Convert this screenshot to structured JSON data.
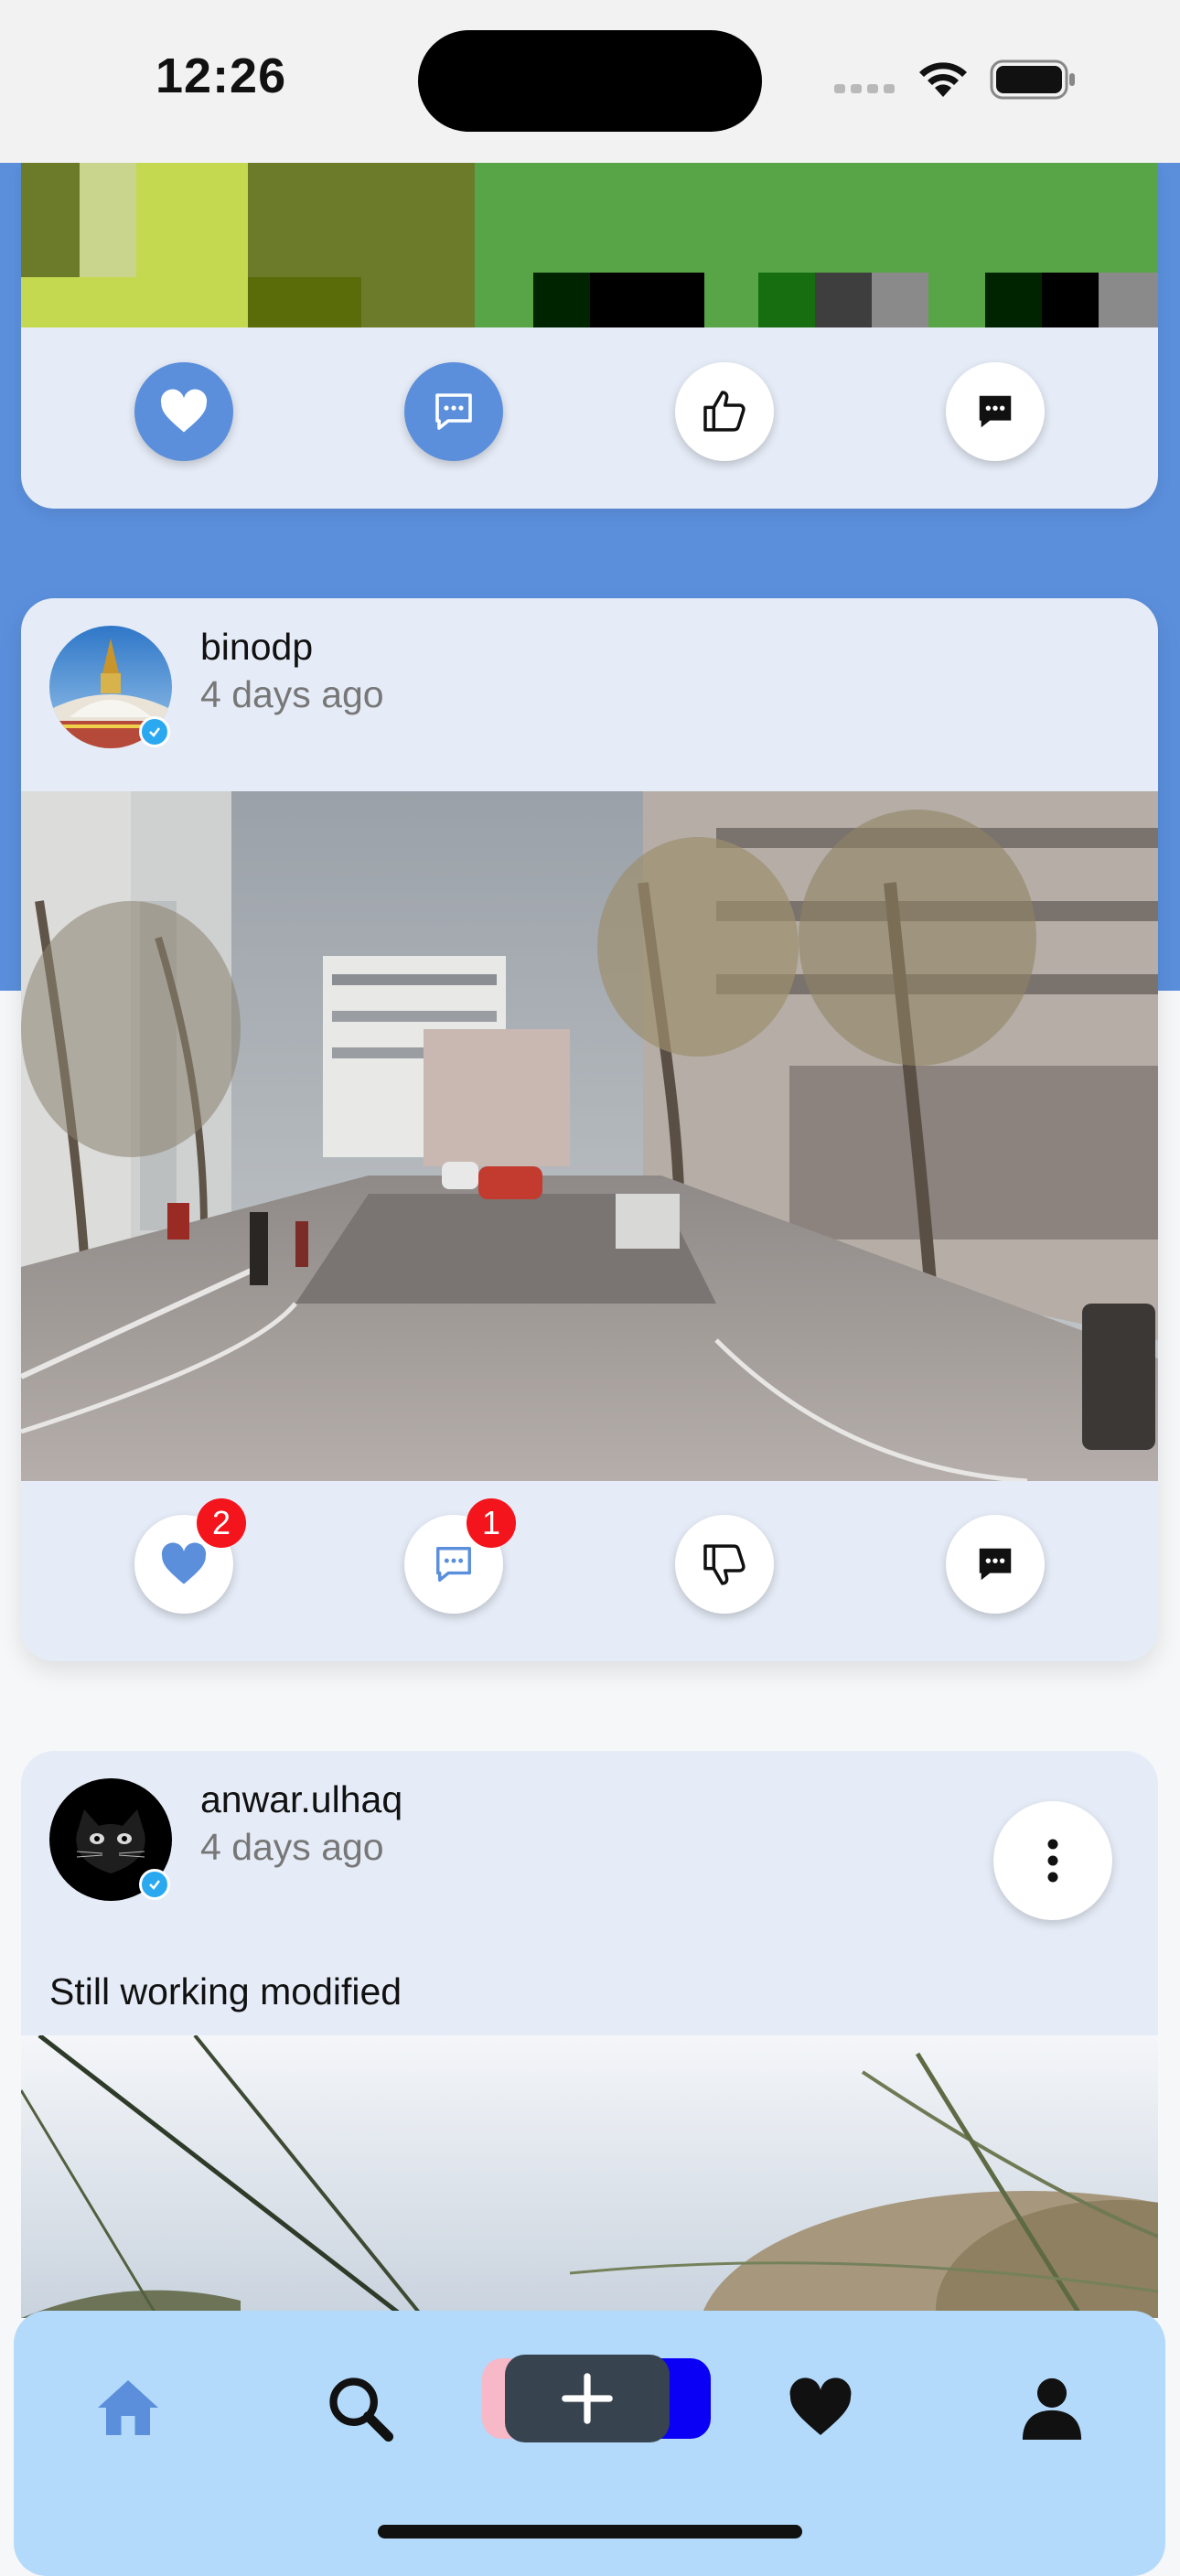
{
  "status_bar": {
    "time": "12:26"
  },
  "posts": [
    {
      "actions": {
        "like_count": "",
        "comment_count": ""
      }
    },
    {
      "username": "binodp",
      "time_ago": "4 days ago",
      "actions": {
        "like_count": "2",
        "comment_count": "1"
      }
    },
    {
      "username": "anwar.ulhaq",
      "time_ago": "4 days ago",
      "caption": "Still working modified"
    }
  ],
  "nav": {
    "items": [
      "home-icon",
      "search-icon",
      "add-post-icon",
      "heart-icon",
      "profile-icon"
    ],
    "active": "home",
    "accent_color": "#5b8fdc"
  },
  "colors": {
    "card_bg": "#e6ecf7",
    "backdrop_blue": "#5b8fdc",
    "badge_red": "#f4141c",
    "nav_bg": "#b3dafb"
  }
}
